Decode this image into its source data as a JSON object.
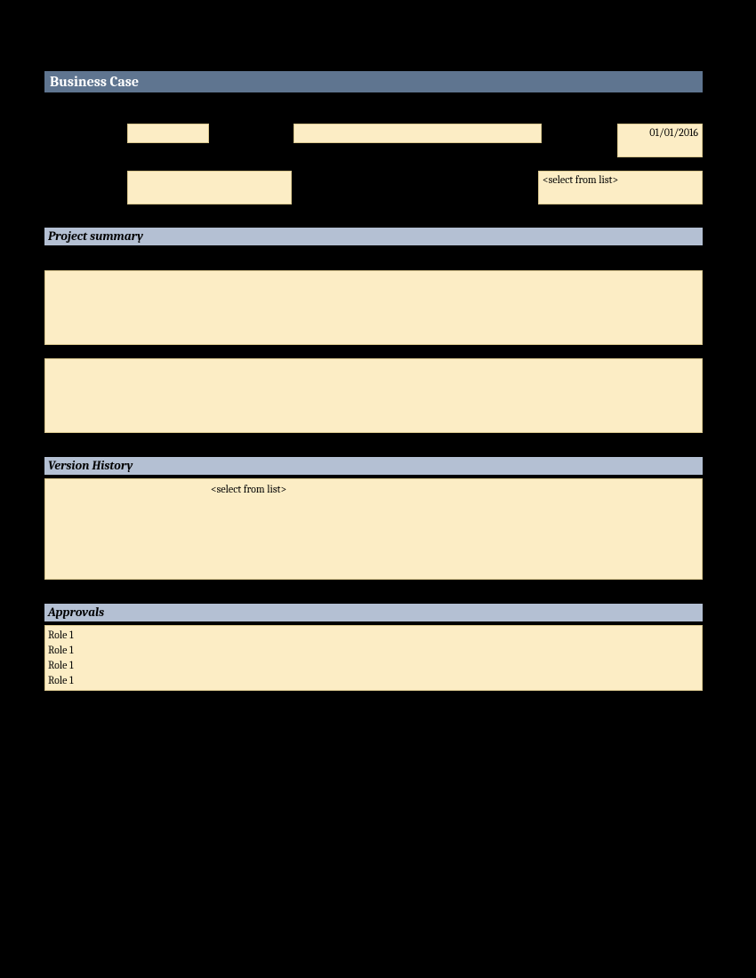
{
  "title": "Business Case",
  "header": {
    "date": "01/01/2016",
    "select_placeholder": "<select from list>"
  },
  "sections": {
    "summary_label": "Project summary",
    "version_label": "Version History",
    "approvals_label": "Approvals"
  },
  "version": {
    "select_placeholder": "<select from list>"
  },
  "approvals": {
    "rows": [
      "Role 1",
      "Role 1",
      "Role 1",
      "Role 1"
    ]
  }
}
